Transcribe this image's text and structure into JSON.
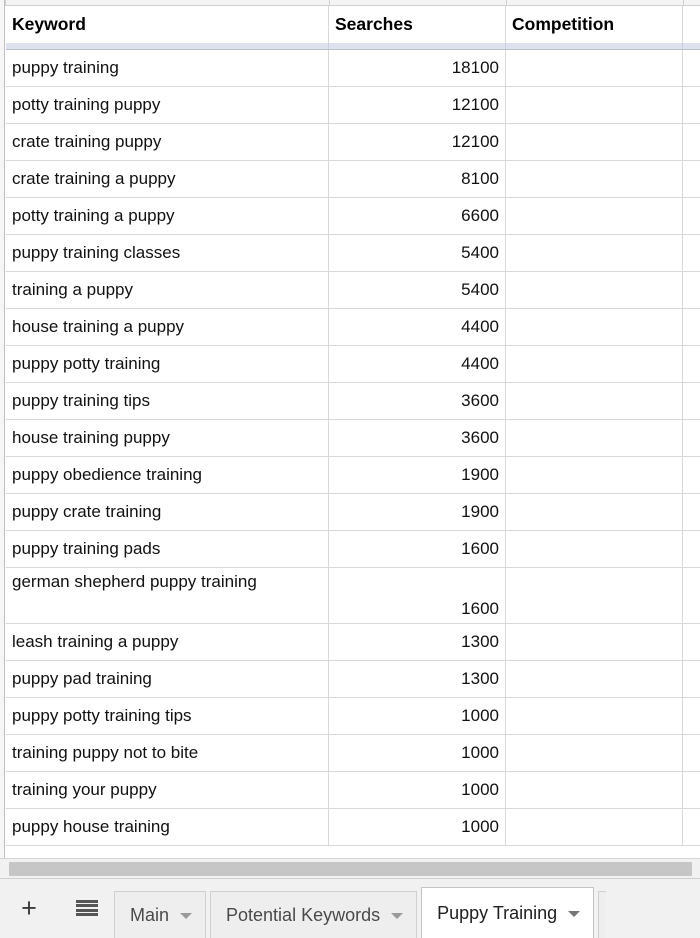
{
  "app": {
    "kind": "spreadsheet",
    "accent_header_bg": "#dde2ee",
    "grid_line_color": "#d9d9d9",
    "active_tab_bg": "#ffffff"
  },
  "grid": {
    "columns": [
      {
        "key": "keyword",
        "label": "Keyword",
        "align": "left"
      },
      {
        "key": "searches",
        "label": "Searches",
        "align": "right"
      },
      {
        "key": "competition",
        "label": "Competition",
        "align": "left"
      }
    ],
    "rows": [
      {
        "keyword": "puppy training",
        "searches": "18100",
        "competition": ""
      },
      {
        "keyword": "potty training puppy",
        "searches": "12100",
        "competition": ""
      },
      {
        "keyword": "crate training puppy",
        "searches": "12100",
        "competition": ""
      },
      {
        "keyword": "crate training a puppy",
        "searches": "8100",
        "competition": ""
      },
      {
        "keyword": "potty training a puppy",
        "searches": "6600",
        "competition": ""
      },
      {
        "keyword": "puppy training classes",
        "searches": "5400",
        "competition": ""
      },
      {
        "keyword": "training a puppy",
        "searches": "5400",
        "competition": ""
      },
      {
        "keyword": "house training a puppy",
        "searches": "4400",
        "competition": ""
      },
      {
        "keyword": "puppy potty training",
        "searches": "4400",
        "competition": ""
      },
      {
        "keyword": "puppy training tips",
        "searches": "3600",
        "competition": ""
      },
      {
        "keyword": "house training puppy",
        "searches": "3600",
        "competition": ""
      },
      {
        "keyword": "puppy obedience training",
        "searches": "1900",
        "competition": ""
      },
      {
        "keyword": "puppy crate training",
        "searches": "1900",
        "competition": ""
      },
      {
        "keyword": "puppy training pads",
        "searches": "1600",
        "competition": ""
      },
      {
        "keyword": "german shepherd puppy training",
        "searches": "1600",
        "competition": "",
        "tall": true
      },
      {
        "keyword": "leash training a puppy",
        "searches": "1300",
        "competition": ""
      },
      {
        "keyword": "puppy pad training",
        "searches": "1300",
        "competition": ""
      },
      {
        "keyword": "puppy potty training tips",
        "searches": "1000",
        "competition": ""
      },
      {
        "keyword": "training puppy not to bite",
        "searches": "1000",
        "competition": ""
      },
      {
        "keyword": "training your puppy",
        "searches": "1000",
        "competition": ""
      },
      {
        "keyword": "puppy house training",
        "searches": "1000",
        "competition": ""
      }
    ]
  },
  "tabbar": {
    "add_sheet_label": "+",
    "all_sheets_icon": "hamburger-icon",
    "tabs": [
      {
        "label": "Main",
        "active": false
      },
      {
        "label": "Potential Keywords",
        "active": false
      },
      {
        "label": "Puppy Training",
        "active": true
      }
    ]
  }
}
